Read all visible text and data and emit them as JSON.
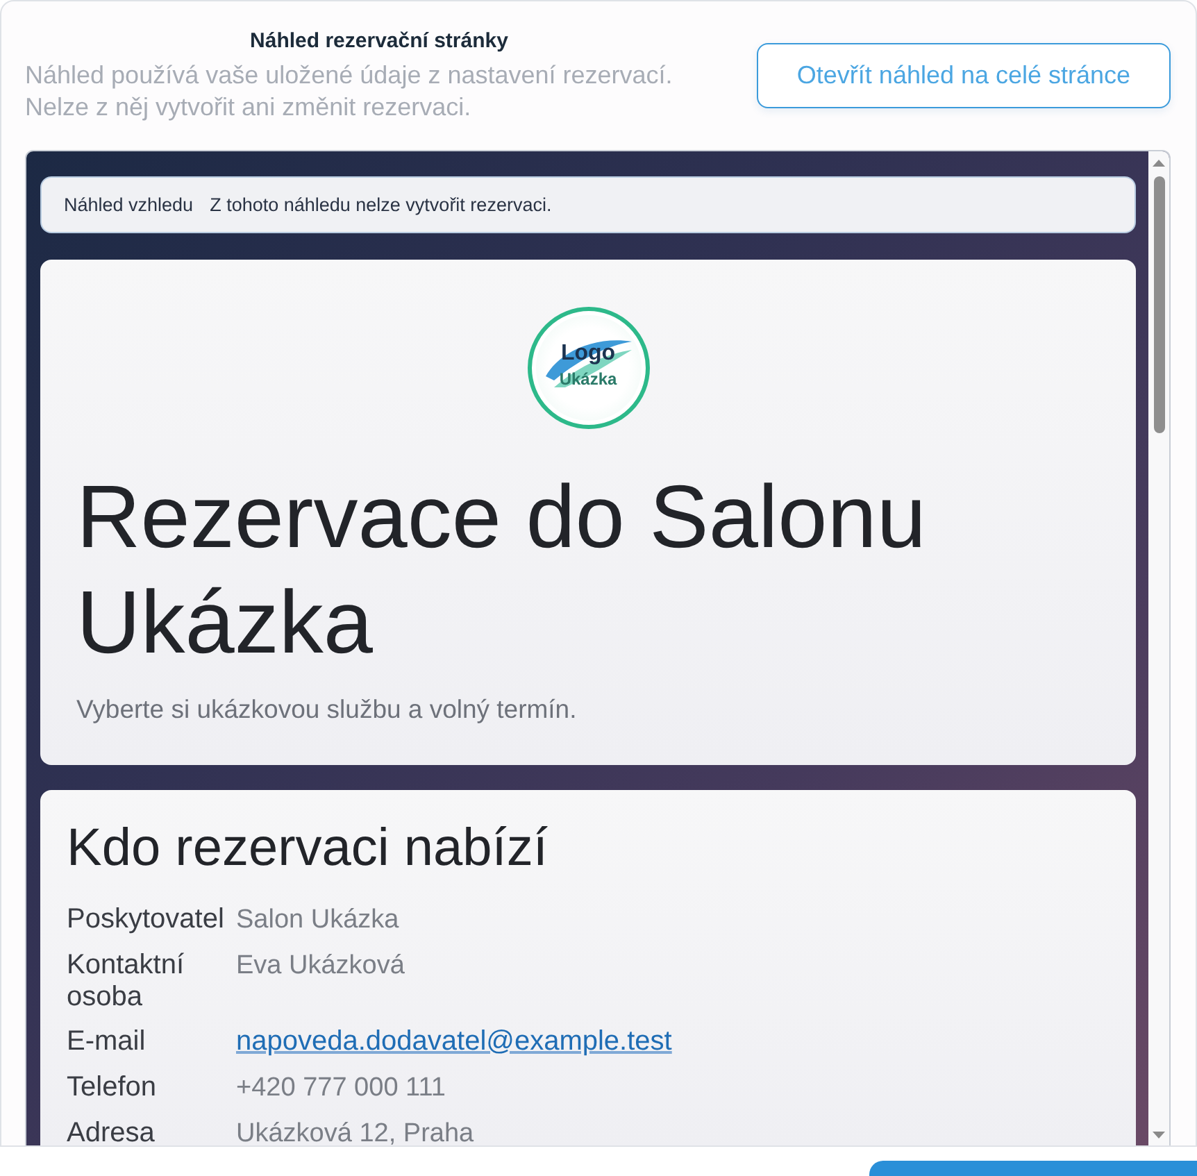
{
  "dialog": {
    "title": "Náhled rezervační stránky",
    "description": [
      "Náhled používá vaše uložené údaje z nastavení rezervací.",
      "Nelze z něj vytvořit ani změnit rezervaci."
    ],
    "open_full_button": "Otevřít náhled na celé stránce"
  },
  "preview": {
    "notice": {
      "label": "Náhled vzhledu",
      "text": "Z tohoto náhledu nelze vytvořit rezervaci."
    },
    "hero": {
      "logo": {
        "text": "Logo",
        "subtext": "Ukázka"
      },
      "title": "Rezervace do Salonu Ukázka",
      "subtitle": "Vyberte si ukázkovou službu a volný termín."
    },
    "provider": {
      "heading": "Kdo rezervaci nabízí",
      "rows": [
        {
          "label": "Poskytovatel",
          "value": "Salon Ukázka",
          "kind": "text"
        },
        {
          "label": "Kontaktní osoba",
          "value": "Eva Ukázková",
          "kind": "text"
        },
        {
          "label": "E-mail",
          "value": "napoveda.dodavatel@example.test",
          "kind": "link"
        },
        {
          "label": "Telefon",
          "value": "+420 777 000 111",
          "kind": "text"
        },
        {
          "label": "Adresa",
          "value": "Ukázková 12, Praha",
          "kind": "text"
        }
      ]
    }
  }
}
